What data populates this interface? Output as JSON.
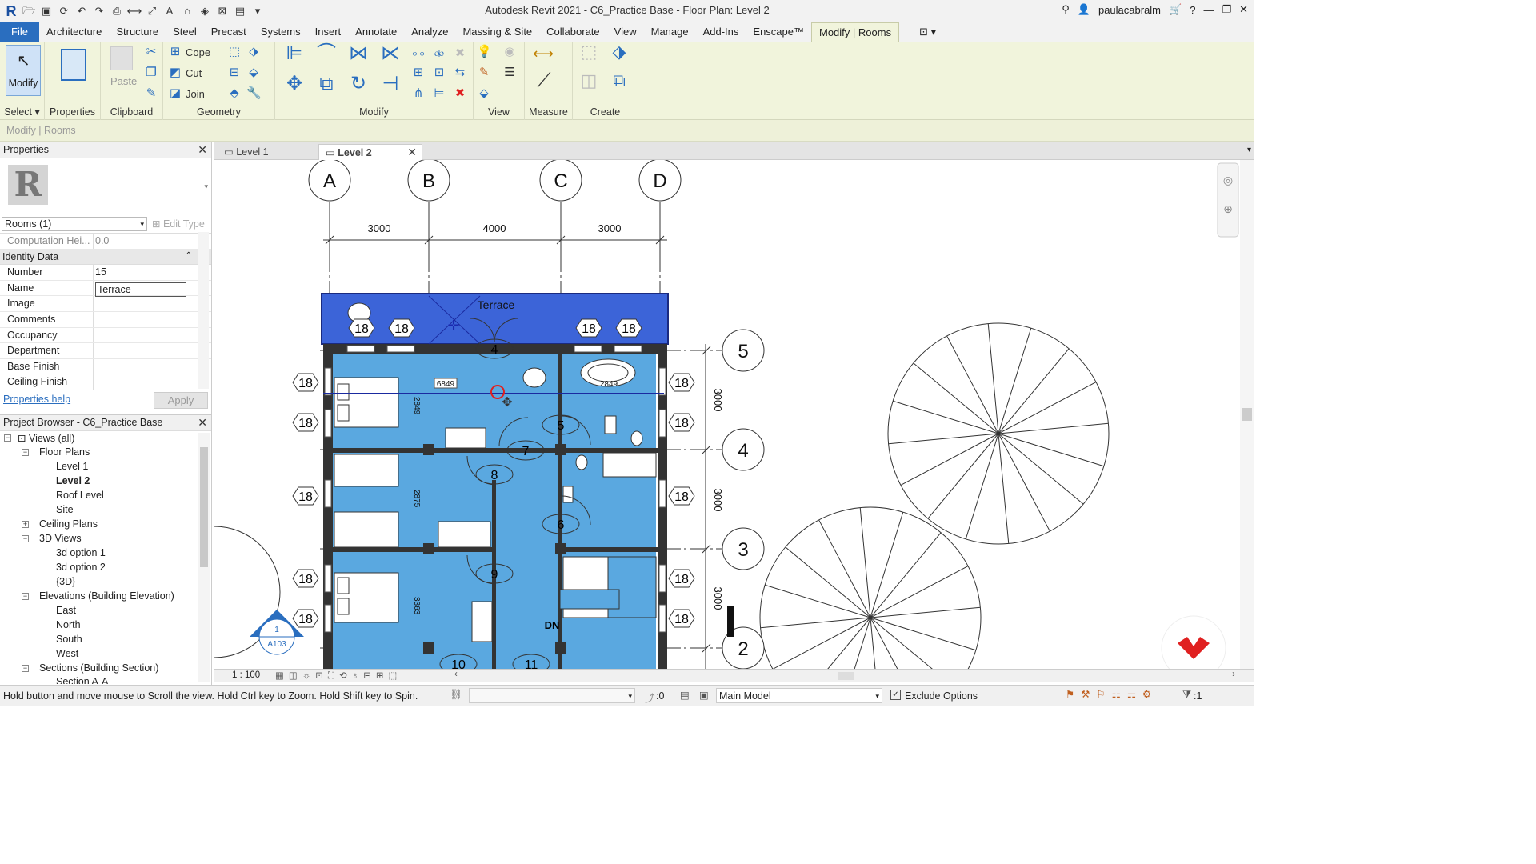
{
  "app": {
    "title": "Autodesk Revit 2021 - C6_Practice Base - Floor Plan: Level 2",
    "user": "paulacabralm"
  },
  "menu": {
    "file": "File",
    "tabs": [
      "Architecture",
      "Structure",
      "Steel",
      "Precast",
      "Systems",
      "Insert",
      "Annotate",
      "Analyze",
      "Massing & Site",
      "Collaborate",
      "View",
      "Manage",
      "Add-Ins",
      "Enscape™",
      "Modify | Rooms"
    ]
  },
  "ribbon": {
    "modify_label": "Modify",
    "paste_label": "Paste",
    "cope_label": "Cope",
    "cut_label": "Cut",
    "join_label": "Join",
    "panels": {
      "select": "Select",
      "properties": "Properties",
      "clipboard": "Clipboard",
      "geometry": "Geometry",
      "modify": "Modify",
      "view": "View",
      "measure": "Measure",
      "create": "Create"
    }
  },
  "context_bar": "Modify | Rooms",
  "properties": {
    "title": "Properties",
    "selector": "Rooms (1)",
    "edit_type": "Edit Type",
    "computation_label": "Computation Hei...",
    "computation_value": "0.0",
    "group": "Identity Data",
    "rows": [
      {
        "key": "Number",
        "value": "15"
      },
      {
        "key": "Name",
        "value": "Terrace"
      },
      {
        "key": "Image",
        "value": ""
      },
      {
        "key": "Comments",
        "value": ""
      },
      {
        "key": "Occupancy",
        "value": ""
      },
      {
        "key": "Department",
        "value": ""
      },
      {
        "key": "Base Finish",
        "value": ""
      },
      {
        "key": "Ceiling Finish",
        "value": ""
      }
    ],
    "help": "Properties help",
    "apply": "Apply"
  },
  "browser": {
    "title": "Project Browser - C6_Practice Base",
    "views_all": "Views (all)",
    "floor_plans": "Floor Plans",
    "level1": "Level 1",
    "level2": "Level 2",
    "roof": "Roof Level",
    "site": "Site",
    "ceiling_plans": "Ceiling Plans",
    "views3d": "3D Views",
    "opt1": "3d option 1",
    "opt2": "3d option 2",
    "v3d": "{3D}",
    "elevations": "Elevations (Building Elevation)",
    "east": "East",
    "north": "North",
    "south": "South",
    "west": "West",
    "sections": "Sections (Building Section)",
    "section_aa": "Section A-A"
  },
  "view_tabs": [
    "Level 1",
    "Level 2"
  ],
  "plan": {
    "grid_cols": [
      "A",
      "B",
      "C",
      "D"
    ],
    "grid_rows": [
      "5",
      "4",
      "3",
      "2"
    ],
    "dims_top": [
      "3000",
      "4000",
      "3000"
    ],
    "dims_right": [
      "3000",
      "3000",
      "3000"
    ],
    "room_terrace": "Terrace",
    "tag_18": "18",
    "door_tags": [
      "4",
      "5",
      "7",
      "8",
      "6",
      "9",
      "10",
      "11"
    ],
    "inner_dims": [
      "6849",
      "2849",
      "2849",
      "2875",
      "3363"
    ],
    "section_tag": "1",
    "section_sheet": "A103",
    "dn": "DN"
  },
  "view_status": {
    "scale": "1 : 100"
  },
  "status": {
    "hint": "Hold button and move mouse to Scroll the view. Hold Ctrl key to Zoom. Hold Shift key to Spin.",
    "zero": ":0",
    "model": "Main Model",
    "exclude": "Exclude Options",
    "filter_count": ":1"
  },
  "colors": {
    "room_fill": "#5aa8e0",
    "terrace_fill": "#3c64d8",
    "ribbon_bg": "#f1f4dc",
    "file_tab": "#2a6ebf"
  }
}
